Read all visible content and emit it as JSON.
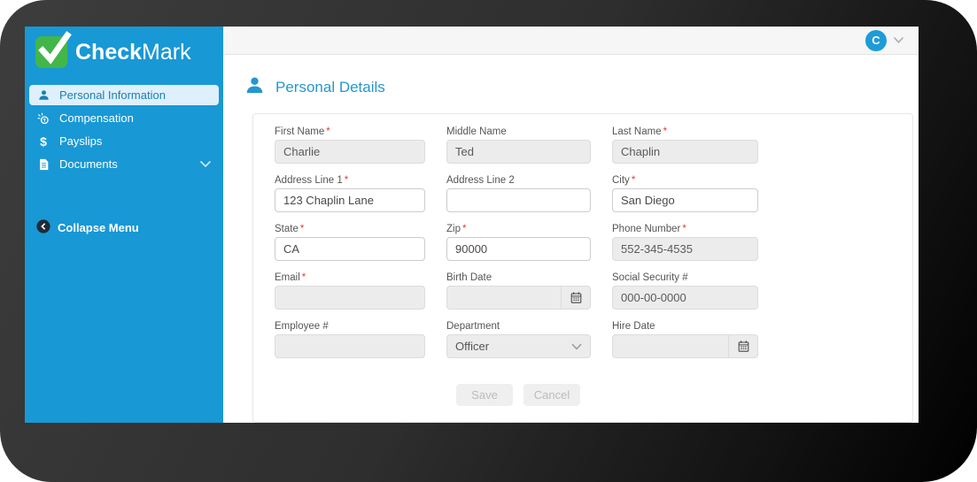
{
  "brand": {
    "bold": "Check",
    "light": "Mark"
  },
  "icons": {
    "payslips_glyph": "$"
  },
  "colors": {
    "sidebar_blue": "#1898d5",
    "logo_green": "#43b649",
    "heading_blue": "#2497cc",
    "active_item_bg": "#def0fb",
    "active_item_text": "#1b7fb3",
    "frame_dark": "#2e2e2e",
    "required_red": "#e03c3c"
  },
  "sidebar": {
    "items": [
      {
        "label": "Personal Information",
        "active": true
      },
      {
        "label": "Compensation",
        "active": false
      },
      {
        "label": "Payslips",
        "active": false
      },
      {
        "label": "Documents",
        "active": false,
        "expandable": true
      }
    ],
    "collapse_label": "Collapse Menu"
  },
  "topbar": {
    "avatar_initial": "C"
  },
  "page": {
    "title": "Personal Details"
  },
  "form": {
    "required_mark": "*",
    "fields": {
      "first_name": {
        "label": "First Name",
        "value": "Charlie",
        "required": true,
        "state": "readonly"
      },
      "middle_name": {
        "label": "Middle Name",
        "value": "Ted",
        "required": false,
        "state": "readonly"
      },
      "last_name": {
        "label": "Last Name",
        "value": "Chaplin",
        "required": true,
        "state": "readonly"
      },
      "address1": {
        "label": "Address Line 1",
        "value": "123 Chaplin Lane",
        "required": true,
        "state": "editable"
      },
      "address2": {
        "label": "Address Line 2",
        "value": "",
        "required": false,
        "state": "editable"
      },
      "city": {
        "label": "City",
        "value": "San Diego",
        "required": true,
        "state": "editable"
      },
      "state": {
        "label": "State",
        "value": "CA",
        "required": true,
        "state": "editable"
      },
      "zip": {
        "label": "Zip",
        "value": "90000",
        "required": true,
        "state": "editable"
      },
      "phone": {
        "label": "Phone Number",
        "value": "552-345-4535",
        "required": true,
        "state": "readonly"
      },
      "email": {
        "label": "Email",
        "value": "",
        "required": true,
        "state": "readonly"
      },
      "birth_date": {
        "label": "Birth Date",
        "value": "",
        "required": false,
        "state": "readonly",
        "addon": "calendar"
      },
      "ssn": {
        "label": "Social Security #",
        "value": "000-00-0000",
        "required": false,
        "state": "readonly"
      },
      "employee_no": {
        "label": "Employee #",
        "value": "",
        "required": false,
        "state": "readonly"
      },
      "department": {
        "label": "Department",
        "value": "Officer",
        "required": false,
        "state": "select"
      },
      "hire_date": {
        "label": "Hire Date",
        "value": "",
        "required": false,
        "state": "readonly",
        "addon": "calendar"
      }
    }
  },
  "actions": {
    "save": "Save",
    "cancel": "Cancel"
  }
}
